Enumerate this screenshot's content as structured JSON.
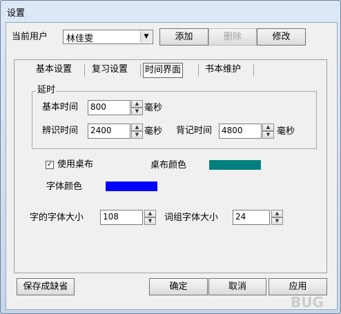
{
  "window": {
    "title": "设置"
  },
  "user": {
    "label": "当前用户",
    "selected": "林佳雯",
    "add": "添加",
    "delete": "删除",
    "modify": "修改"
  },
  "tabs": [
    "基本设置",
    "复习设置",
    "时间界面",
    "书本维护"
  ],
  "delay": {
    "group_label": "延时",
    "basic_label": "基本时间",
    "basic_value": "800",
    "recog_label": "辨识时间",
    "recog_value": "2400",
    "recite_label": "背记时间",
    "recite_value": "4800",
    "unit": "毫秒"
  },
  "appearance": {
    "use_tablecloth": "使用桌布",
    "use_tablecloth_checked": true,
    "check_mark": "✓",
    "tablecloth_color_label": "桌布颜色",
    "tablecloth_color": "#008080",
    "font_color_label": "字体颜色",
    "font_color": "#0000ff"
  },
  "sizes": {
    "char_font_label": "字的字体大小",
    "char_font_value": "108",
    "phrase_font_label": "词组字体大小",
    "phrase_font_value": "24"
  },
  "footer": {
    "save_default": "保存成缺省",
    "ok": "确定",
    "cancel": "取消",
    "apply": "应用"
  },
  "watermark": "BUG"
}
